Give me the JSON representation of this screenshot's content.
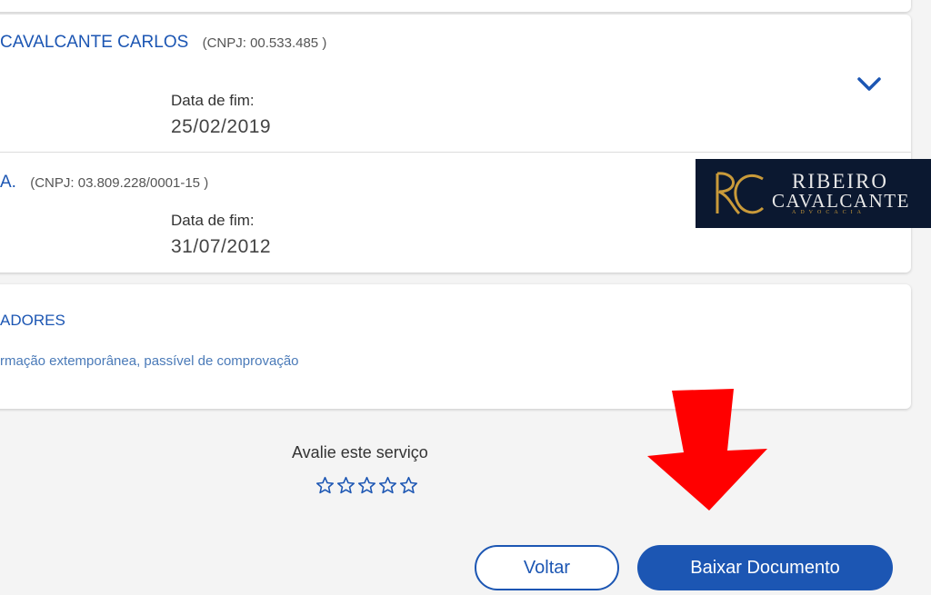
{
  "records": [
    {
      "employer": "CAVALCANTE CARLOS",
      "cnpj": "(CNPJ: 00.533.485 )",
      "end_label": "Data de fim:",
      "end_date": "25/02/2019"
    },
    {
      "employer": "A.",
      "cnpj": "(CNPJ: 03.809.228/0001-15 )",
      "end_label": "Data de fim:",
      "end_date": "31/07/2012"
    }
  ],
  "indicators": {
    "title": "ADORES",
    "text": "rmação extemporânea, passível de comprovação"
  },
  "rating": {
    "label": "Avalie este serviço",
    "max_stars": 5,
    "selected": 0
  },
  "buttons": {
    "back": "Voltar",
    "download": "Baixar Documento"
  },
  "logo": {
    "line1": "RIBEIRO",
    "line2": "CAVALCANTE",
    "line3": "ADVOCACIA"
  },
  "colors": {
    "accent": "#1c56b3",
    "arrow": "#ff0000",
    "logo_bg": "#0b1830",
    "logo_gold": "#c99a3a"
  },
  "icons": [
    "chevron-down-icon",
    "star-outline-icon",
    "red-arrow-annotation"
  ]
}
